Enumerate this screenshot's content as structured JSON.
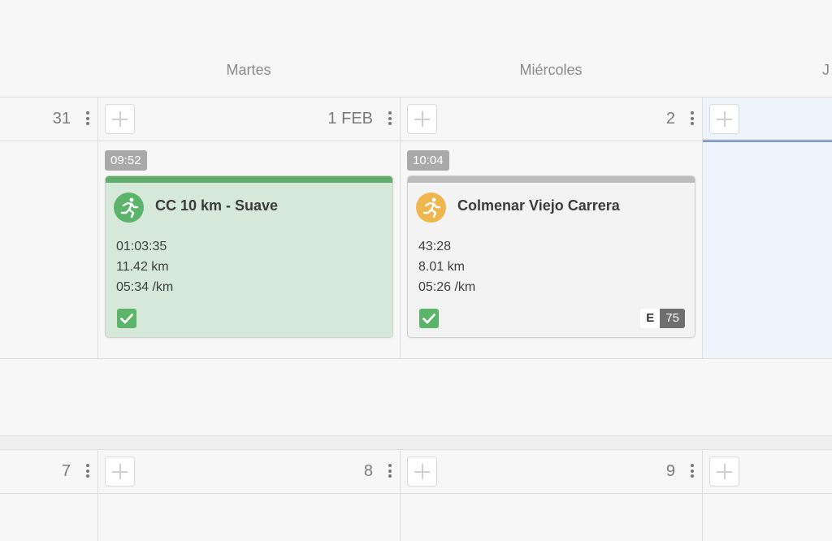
{
  "week_headers": {
    "tuesday": "Martes",
    "wednesday": "Miércoles",
    "thursday_partial": "J"
  },
  "week1": {
    "dates": {
      "monday": "31",
      "tuesday": "1 FEB",
      "wednesday": "2"
    },
    "activities": [
      {
        "time": "09:52",
        "title": "CC 10 km - Suave",
        "duration": "01:03:35",
        "distance": "11.42 km",
        "pace": "05:34 /km",
        "completed": true,
        "colors": {
          "bar": "#5fae6c",
          "background": "#d5e8da",
          "icon": "#5cb46a"
        }
      },
      {
        "time": "10:04",
        "title": "Colmenar Viejo Carrera",
        "duration": "43:28",
        "distance": "8.01 km",
        "pace": "05:26 /km",
        "completed": true,
        "effort_label": "E",
        "effort_value": "75",
        "colors": {
          "bar": "#bdbdbd",
          "background": "#f3f3f3",
          "icon": "#efb64f"
        }
      }
    ]
  },
  "week2": {
    "dates": {
      "monday": "7",
      "tuesday": "8",
      "wednesday": "9"
    }
  },
  "icons": {
    "activity": "running-icon",
    "add": "plus-icon",
    "menu": "kebab-menu-icon",
    "done": "checkmark-icon"
  },
  "colors": {
    "today_highlight": "#edf4fc",
    "today_line": "#5b7fd0"
  }
}
